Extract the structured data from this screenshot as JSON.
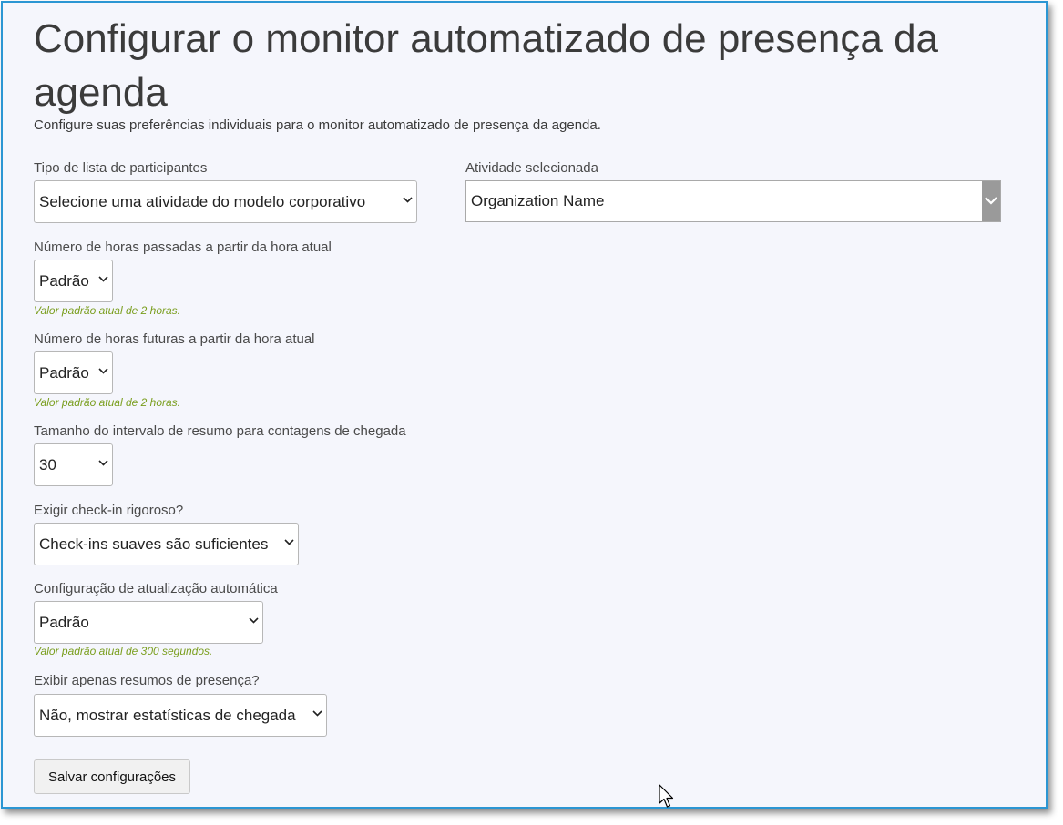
{
  "page": {
    "title": "Configurar o monitor automatizado de presença da agenda",
    "subtitle": "Configure suas preferências individuais para o monitor automatizado de presença da agenda."
  },
  "form": {
    "attendee_list_type": {
      "label": "Tipo de lista de participantes",
      "selected": "Selecione uma atividade do modelo corporativo"
    },
    "selected_activity": {
      "label": "Atividade selecionada",
      "selected": "Organization Name"
    },
    "hours_past": {
      "label": "Número de horas passadas a partir da hora atual",
      "selected": "Padrão",
      "hint": "Valor padrão atual de 2 horas."
    },
    "hours_future": {
      "label": "Número de horas futuras a partir da hora atual",
      "selected": "Padrão",
      "hint": "Valor padrão atual de 2 horas."
    },
    "summary_interval": {
      "label": "Tamanho do intervalo de resumo para contagens de chegada",
      "selected": "30"
    },
    "strict_checkin": {
      "label": "Exigir check-in rigoroso?",
      "selected": "Check-ins suaves são suficientes"
    },
    "auto_refresh": {
      "label": "Configuração de atualização automática",
      "selected": "Padrão",
      "hint": "Valor padrão atual de 300 segundos."
    },
    "summaries_only": {
      "label": "Exibir apenas resumos de presença?",
      "selected": "Não, mostrar estatísticas de chegada"
    },
    "save_label": "Salvar configurações"
  },
  "colors": {
    "frame_border": "#2b96d3",
    "background": "#f5f6fc",
    "hint_text": "#7a9e1e"
  },
  "icons": {
    "dropdown": "chevron-down-icon",
    "pointer": "mouse-cursor-icon"
  }
}
